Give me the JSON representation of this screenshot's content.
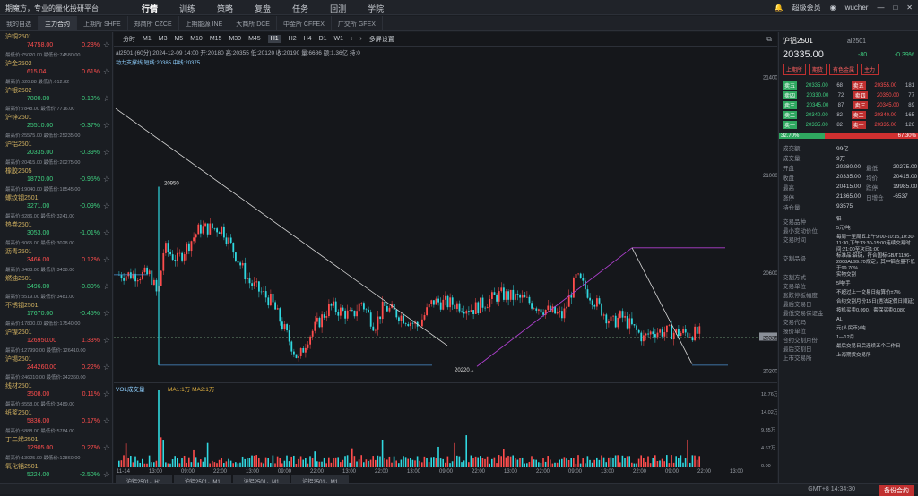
{
  "app": {
    "title": "期魔方，专业的量化投研平台",
    "nav": [
      "行情",
      "训练",
      "策略",
      "复盘",
      "任务",
      "回测",
      "学院"
    ],
    "nav_active": 0,
    "user": "wucher",
    "vip": "超级会员"
  },
  "market_tabs": [
    "我的自选",
    "主力合约",
    "上期所 SHFE",
    "郑商所 CZCE",
    "上期能源 INE",
    "大商所 DCE",
    "中金所 CFFEX",
    "广交所 GFEX"
  ],
  "watchlist": [
    {
      "name": "沪铜2501",
      "price": "74758.00",
      "change": "0.28%",
      "dir": "up",
      "sub": "最低价:75020.00   最低价:74580.00"
    },
    {
      "name": "沪金2502",
      "price": "615.04",
      "change": "0.61%",
      "dir": "up",
      "sub": "最高价:620.88   最低价:612.82"
    },
    {
      "name": "沪银2502",
      "price": "7800.00",
      "change": "-0.13%",
      "dir": "dn",
      "sub": "最高价:7848.00   最低价:7716.00"
    },
    {
      "name": "沪锌2501",
      "price": "25510.00",
      "change": "-0.37%",
      "dir": "dn",
      "sub": "最高价:25575.00   最低价:25235.00"
    },
    {
      "name": "沪铝2501",
      "price": "20335.00",
      "change": "-0.39%",
      "dir": "dn",
      "sub": "最高价:20415.00   最低价:20275.00"
    },
    {
      "name": "橡胶2505",
      "price": "18720.00",
      "change": "-0.95%",
      "dir": "dn",
      "sub": "最高价:19040.00   最低价:18545.00"
    },
    {
      "name": "螺纹钢2501",
      "price": "3271.00",
      "change": "-0.09%",
      "dir": "dn",
      "sub": "最高价:3286.00   最低价:3241.00"
    },
    {
      "name": "热卷2501",
      "price": "3053.00",
      "change": "-1.01%",
      "dir": "dn",
      "sub": "最高价:3065.00   最低价:3028.00"
    },
    {
      "name": "沥青2501",
      "price": "3466.00",
      "change": "0.12%",
      "dir": "up",
      "sub": "最高价:3483.00   最低价:3438.00"
    },
    {
      "name": "燃油2501",
      "price": "3496.00",
      "change": "-0.80%",
      "dir": "dn",
      "sub": "最高价:3519.00   最低价:3481.00"
    },
    {
      "name": "不锈钢2501",
      "price": "17670.00",
      "change": "-0.45%",
      "dir": "dn",
      "sub": "最高价:17800.00   最低价:17540.00"
    },
    {
      "name": "沪镍2501",
      "price": "126950.00",
      "change": "1.33%",
      "dir": "up",
      "sub": "最高价:127990.00   最低价:126410.00"
    },
    {
      "name": "沪锡2501",
      "price": "244260.00",
      "change": "0.22%",
      "dir": "up",
      "sub": "最高价:246010.00   最低价:242360.00"
    },
    {
      "name": "线材2501",
      "price": "3508.00",
      "change": "0.11%",
      "dir": "up",
      "sub": "最高价:3558.00   最低价:3489.00"
    },
    {
      "name": "纸浆2501",
      "price": "5836.00",
      "change": "0.17%",
      "dir": "up",
      "sub": "最高价:5888.00   最低价:5784.00"
    },
    {
      "name": "丁二烯2501",
      "price": "12905.00",
      "change": "0.27%",
      "dir": "up",
      "sub": "最高价:13025.00   最低价:12860.00"
    },
    {
      "name": "氧化铝2501",
      "price": "5224.00",
      "change": "-2.50%",
      "dir": "dn",
      "sub": ""
    }
  ],
  "toolbar": {
    "periods": [
      "分时",
      "M1",
      "M3",
      "M5",
      "M10",
      "M15",
      "M30",
      "M45",
      "H1",
      "H2",
      "H4",
      "D1",
      "W1"
    ],
    "active": "H1",
    "multi": "多屏设置"
  },
  "chart_info": "al2501 (60分)  2024-12-09 14:00  开:20180  高:20355  低:20120  收:20190  量:6686  额:1.36亿  持:0",
  "indicator_line": "动力支撑线  短线:20385 中线:20375",
  "price_axis": [
    "21400",
    "21000",
    "20600",
    "20335",
    "20200"
  ],
  "chart_labels": {
    "high": "20950",
    "low": "20220"
  },
  "vol": {
    "label": "VOL成交量",
    "ma": "MA1:1万  MA2:1万",
    "axis": [
      "18.76万",
      "14.02万",
      "9.35万",
      "4.67万",
      "0.00"
    ]
  },
  "time_axis": [
    "11-14",
    "13:00",
    "09:00",
    "22:00",
    "13:00",
    "09:00",
    "22:00",
    "13:00",
    "22:00",
    "13:00",
    "09:00",
    "22:00",
    "13:00",
    "22:00",
    "09:00",
    "13:00",
    "22:00",
    "09:00",
    "22:00",
    "13:00"
  ],
  "bottom_tabs": [
    "沪铝2501，H1",
    "沪铝2501，M1",
    "沪铝2501，M1",
    "沪铝2501，M1"
  ],
  "right": {
    "name": "沪铝2501",
    "code": "al2501",
    "price": "20335.00",
    "chg": "-80",
    "pct": "-0.39%",
    "tags": [
      "上期所",
      "期货",
      "有色金属",
      "主力"
    ],
    "asks": [
      [
        "卖五",
        "20335.00",
        "68",
        "20355.00",
        "181"
      ],
      [
        "卖四",
        "20330.00",
        "72",
        "20350.00",
        "77"
      ],
      [
        "卖三",
        "20345.00",
        "87",
        "20345.00",
        "89"
      ],
      [
        "卖二",
        "20340.00",
        "82",
        "20340.00",
        "165"
      ],
      [
        "卖一",
        "20335.00",
        "82",
        "20335.00",
        "126"
      ]
    ],
    "ratio": [
      "32.70%",
      "67.30%"
    ],
    "stats": [
      [
        "成交额",
        "99亿"
      ],
      [
        "成交量",
        "9万"
      ],
      [
        "开盘",
        "20280.00"
      ],
      [
        "收盘",
        "20335.00"
      ],
      [
        "最高",
        "20415.00"
      ],
      [
        "涨停",
        "21365.00"
      ],
      [
        "持仓量",
        "93575"
      ]
    ],
    "stats2": [
      [
        "最低",
        "20275.00"
      ],
      [
        "均价",
        "20415.00"
      ],
      [
        "跌停",
        "19985.00"
      ],
      [
        "日增仓",
        "-6537"
      ]
    ],
    "specs": [
      [
        "交易品种",
        "铝"
      ],
      [
        "最小变动价位",
        "5元/吨"
      ],
      [
        "交易时间",
        "每周一至周五上午9:00-10:15,10:30-11:30,下午13:30-15:00连续交易时间:21:00至次日1:00"
      ],
      [
        "交割品级",
        "标准品:铝锭，符合国标GB/T1196-2008AL99.70规定，其中铝含量不低于99.70%"
      ],
      [
        "交割方式",
        "实物交割"
      ],
      [
        "交易单位",
        "5吨/手"
      ],
      [
        "涨跌停板幅度",
        "不超过上一交易日结算价±7%"
      ],
      [
        "最后交易日",
        "合约交割月份15日(遇法定假日顺延)"
      ],
      [
        "最低交易保证金",
        "按机买卖0.090，套保买卖0.080"
      ],
      [
        "交易代码",
        "AL"
      ],
      [
        "报价单位",
        "元(人民币)/吨"
      ],
      [
        "合约交割月份",
        "1—12月"
      ],
      [
        "最后交割日",
        "最后交易日后连续五个工作日"
      ],
      [
        "上市交易所",
        "上海期货交易所"
      ]
    ],
    "btabs": [
      "合约",
      "新闻"
    ]
  },
  "status": "GMT+8 14:34:30",
  "status_btn": "备份合约"
}
